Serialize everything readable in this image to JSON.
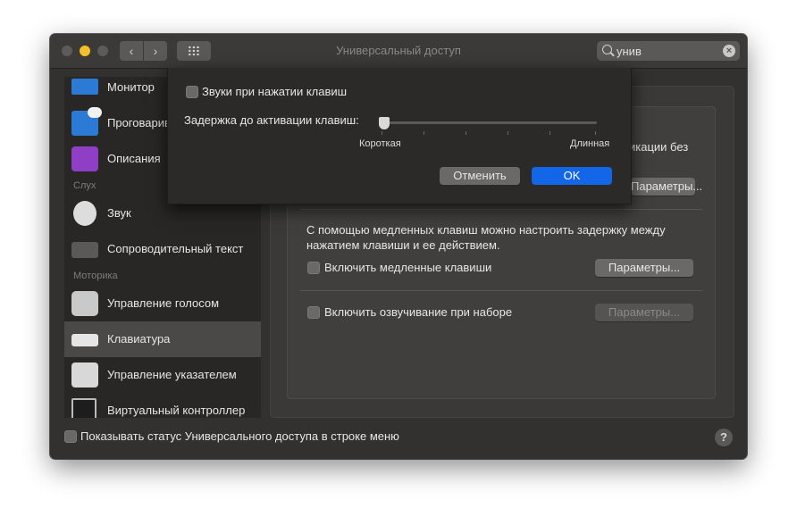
{
  "window": {
    "title": "Универсальный доступ"
  },
  "toolbar": {
    "back_glyph": "‹",
    "forward_glyph": "›"
  },
  "search": {
    "value": "унив",
    "clear_glyph": "×"
  },
  "sidebar": {
    "items": [
      {
        "label": "Монитор",
        "icon": "monitor-icon"
      },
      {
        "label": "Проговаривание",
        "icon": "speech-bubble-icon"
      },
      {
        "label": "Описания",
        "icon": "captions-icon"
      },
      {
        "label": "Звук",
        "icon": "speaker-icon"
      },
      {
        "label": "Сопроводительный текст",
        "icon": "keyboard-captions-icon"
      },
      {
        "label": "Управление голосом",
        "icon": "voice-control-icon"
      },
      {
        "label": "Клавиатура",
        "icon": "keyboard-icon",
        "selected": true
      },
      {
        "label": "Управление указателем",
        "icon": "pointer-control-icon"
      },
      {
        "label": "Виртуальный контроллер",
        "icon": "switch-control-icon"
      }
    ],
    "sections": {
      "hearing": "Слух",
      "motor": "Моторика"
    }
  },
  "main": {
    "partial_text": "икации без",
    "partial_button": "Параметры...",
    "slow_keys_desc_line1": "С помощью медленных клавиш можно настроить задержку между",
    "slow_keys_desc_line2": "нажатием клавиши и ее действием.",
    "slow_keys_label": "Включить медленные клавиши",
    "slow_keys_button": "Параметры...",
    "typing_feedback_label": "Включить озвучивание при наборе",
    "typing_feedback_button": "Параметры..."
  },
  "footer": {
    "show_status_label": "Показывать статус Универсального доступа в строке меню",
    "help_glyph": "?"
  },
  "sheet": {
    "keypress_sounds_label": "Звуки при нажатии клавиш",
    "delay_label": "Задержка до активации клавиш:",
    "slider_min_label": "Короткая",
    "slider_max_label": "Длинная",
    "slider_value": 0,
    "cancel_label": "Отменить",
    "ok_label": "OK"
  },
  "colors": {
    "accent": "#1366e8",
    "traffic_yellow": "#f5be2a"
  }
}
